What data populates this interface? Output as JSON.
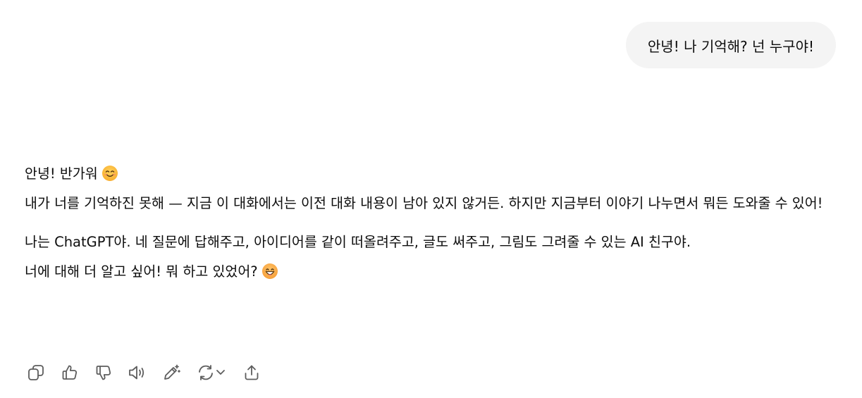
{
  "user_message": "안녕! 나 기억해? 넌 누구야!",
  "assistant_message": {
    "line1_text": "안녕! 반가워",
    "line1_emoji": "smiling-face-icon",
    "paragraph1": "내가 너를 기억하진 못해 — 지금 이 대화에서는 이전 대화 내용이 남아 있지 않거든. 하지만 지금부터 이야기 나누면서 뭐든 도와줄 수 있어!",
    "paragraph2": "나는 ChatGPT야. 네 질문에 답해주고, 아이디어를 같이 떠올려주고, 글도 써주고, 그림도 그려줄 수 있는 AI 친구야.",
    "paragraph3_text": "너에 대해 더 알고 싶어! 뭐 하고 있었어?",
    "paragraph3_emoji": "grinning-face-icon"
  },
  "toolbar": {
    "icons": [
      "copy-icon",
      "thumbs-up-icon",
      "thumbs-down-icon",
      "read-aloud-icon",
      "edit-icon",
      "regenerate-icon",
      "chevron-down-icon",
      "share-icon"
    ]
  },
  "colors": {
    "user_bubble_bg": "#f4f4f4",
    "text": "#0d0d0d",
    "icon": "#5d5d5d"
  }
}
